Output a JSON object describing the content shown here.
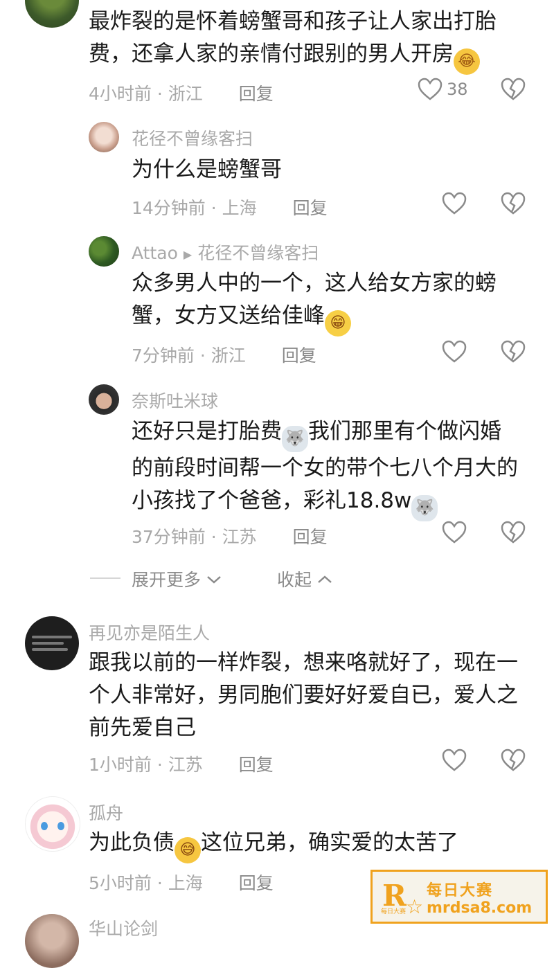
{
  "comments": [
    {
      "text_lines": [
        "最炸裂的是怀着螃蟹哥和孩子让人家出打胎",
        "费，还拿人家的亲情付跟别的男人开房"
      ],
      "time": "4小时前",
      "location": "浙江",
      "reply_label": "回复",
      "like_count": "38",
      "emoji": "laughing-crying-emoji"
    },
    {
      "name": "花径不曾缘客扫",
      "text_lines": [
        "为什么是螃蟹哥"
      ],
      "time": "14分钟前",
      "location": "上海",
      "reply_label": "回复"
    },
    {
      "name": "Attao",
      "reply_to": "花径不曾缘客扫",
      "text_lines": [
        "众多男人中的一个，这人给女方家的螃",
        "蟹，女方又送给佳峰"
      ],
      "time": "7分钟前",
      "location": "浙江",
      "reply_label": "回复",
      "emoji": "grin-emoji"
    },
    {
      "name": "奈斯吐米球",
      "text_lines": [
        "还好只是打胎费",
        "我们那里有个做闪婚",
        "的前段时间帮一个女的带个七八个月大的",
        "小孩找了个爸爸，彩礼18.8w"
      ],
      "time": "37分钟前",
      "location": "江苏",
      "reply_label": "回复",
      "emoji": "dog-emoji"
    },
    {
      "name": "再见亦是陌生人",
      "text_lines": [
        "跟我以前的一样炸裂，想来咯就好了，现在一",
        "个人非常好，男同胞们要好好爱自已，爱人之",
        "前先爱自己"
      ],
      "time": "1小时前",
      "location": "江苏",
      "reply_label": "回复"
    },
    {
      "name": "孤舟",
      "text_lines": [
        "为此负债",
        "这位兄弟，确实爱的太苦了"
      ],
      "time": "5小时前",
      "location": "上海",
      "reply_label": "回复",
      "emoji": "sweat-smile-emoji"
    },
    {
      "name": "华山论剑"
    }
  ],
  "expand": {
    "more_label": "展开更多",
    "collapse_label": "收起"
  },
  "watermark": {
    "logo": "R",
    "small": "每日大赛",
    "title": "每日大赛",
    "url": "mrdsa8.com"
  }
}
